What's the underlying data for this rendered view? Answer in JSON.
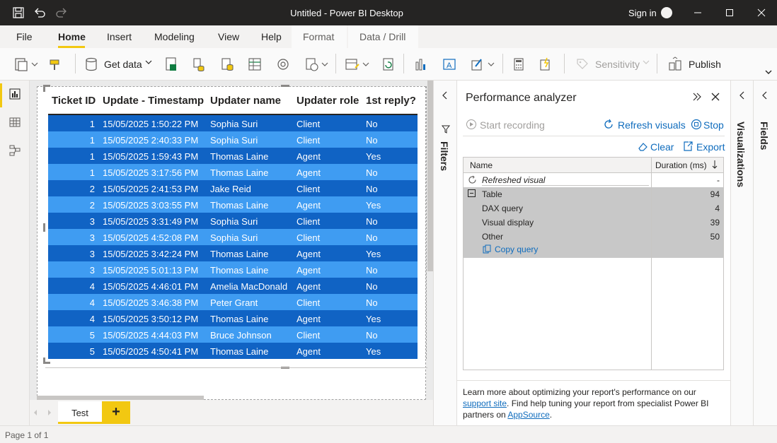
{
  "window": {
    "title": "Untitled - Power BI Desktop",
    "sign_in": "Sign in"
  },
  "ribbon_tabs": [
    "File",
    "Home",
    "Insert",
    "Modeling",
    "View",
    "Help",
    "Format",
    "Data / Drill"
  ],
  "ribbon": {
    "get_data": "Get data",
    "sensitivity": "Sensitivity",
    "publish": "Publish"
  },
  "table": {
    "headers": [
      "Ticket ID",
      "Update - Timestamp",
      "Updater name",
      "Updater role",
      "1st reply?"
    ],
    "rows": [
      [
        "1",
        "15/05/2025 1:50:22 PM",
        "Sophia Suri",
        "Client",
        "No"
      ],
      [
        "1",
        "15/05/2025 2:40:33 PM",
        "Sophia Suri",
        "Client",
        "No"
      ],
      [
        "1",
        "15/05/2025 1:59:43 PM",
        "Thomas Laine",
        "Agent",
        "Yes"
      ],
      [
        "1",
        "15/05/2025 3:17:56 PM",
        "Thomas Laine",
        "Agent",
        "No"
      ],
      [
        "2",
        "15/05/2025 2:41:53 PM",
        "Jake Reid",
        "Client",
        "No"
      ],
      [
        "2",
        "15/05/2025 3:03:55 PM",
        "Thomas Laine",
        "Agent",
        "Yes"
      ],
      [
        "3",
        "15/05/2025 3:31:49 PM",
        "Sophia Suri",
        "Client",
        "No"
      ],
      [
        "3",
        "15/05/2025 4:52:08 PM",
        "Sophia Suri",
        "Client",
        "No"
      ],
      [
        "3",
        "15/05/2025 3:42:24 PM",
        "Thomas Laine",
        "Agent",
        "Yes"
      ],
      [
        "3",
        "15/05/2025 5:01:13 PM",
        "Thomas Laine",
        "Agent",
        "No"
      ],
      [
        "4",
        "15/05/2025 4:46:01 PM",
        "Amelia MacDonald",
        "Agent",
        "No"
      ],
      [
        "4",
        "15/05/2025 3:46:38 PM",
        "Peter Grant",
        "Client",
        "No"
      ],
      [
        "4",
        "15/05/2025 3:50:12 PM",
        "Thomas Laine",
        "Agent",
        "Yes"
      ],
      [
        "5",
        "15/05/2025 4:44:03 PM",
        "Bruce Johnson",
        "Client",
        "No"
      ],
      [
        "5",
        "15/05/2025 4:50:41 PM",
        "Thomas Laine",
        "Agent",
        "Yes"
      ]
    ],
    "row_colors": [
      "#1063c4",
      "#3f9cf2"
    ]
  },
  "filters_label": "Filters",
  "perf": {
    "title": "Performance analyzer",
    "start_recording": "Start recording",
    "refresh_visuals": "Refresh visuals",
    "stop": "Stop",
    "clear": "Clear",
    "export": "Export",
    "col_name": "Name",
    "col_duration": "Duration (ms)",
    "refreshed_visual": "Refreshed visual",
    "refreshed_duration": "-",
    "table_label": "Table",
    "table_duration": "94",
    "dax_label": "DAX query",
    "dax_duration": "4",
    "visual_display_label": "Visual display",
    "visual_display_duration": "39",
    "other_label": "Other",
    "other_duration": "50",
    "copy_query": "Copy query",
    "foot_text_1": "Learn more about optimizing your report's performance on our ",
    "foot_link_1": "support site",
    "foot_text_2": ". Find help tuning your report from specialist Power BI partners on ",
    "foot_link_2": "AppSource",
    "foot_text_3": "."
  },
  "visualizations_label": "Visualizations",
  "fields_label": "Fields",
  "page_tab": "Test",
  "add_page": "+",
  "status": "Page 1 of 1"
}
